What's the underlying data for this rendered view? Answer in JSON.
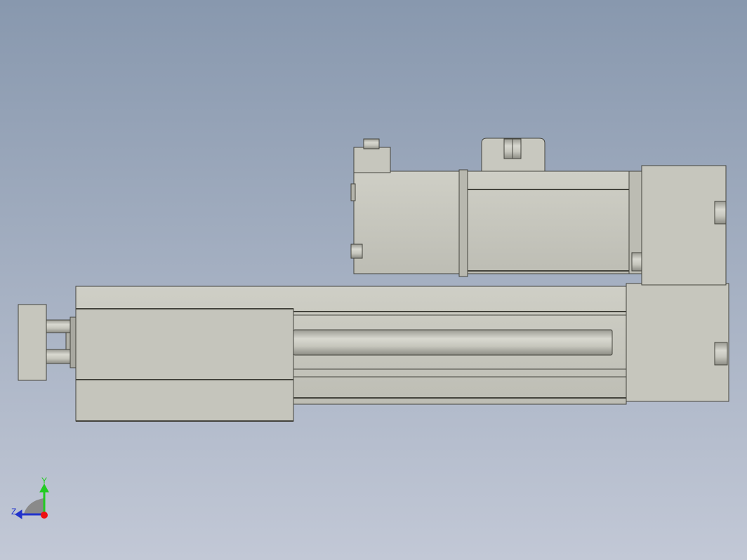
{
  "view": {
    "background_top": "#8898ae",
    "background_bottom": "#c2c8d6",
    "part_color": "#c3c3ba",
    "edge_color": "#44443d"
  },
  "triad": {
    "x_label": "",
    "y_label": "Y",
    "z_label": "Z",
    "y_color": "#22cc22",
    "z_color": "#2233cc",
    "origin_color": "#ee1111"
  }
}
